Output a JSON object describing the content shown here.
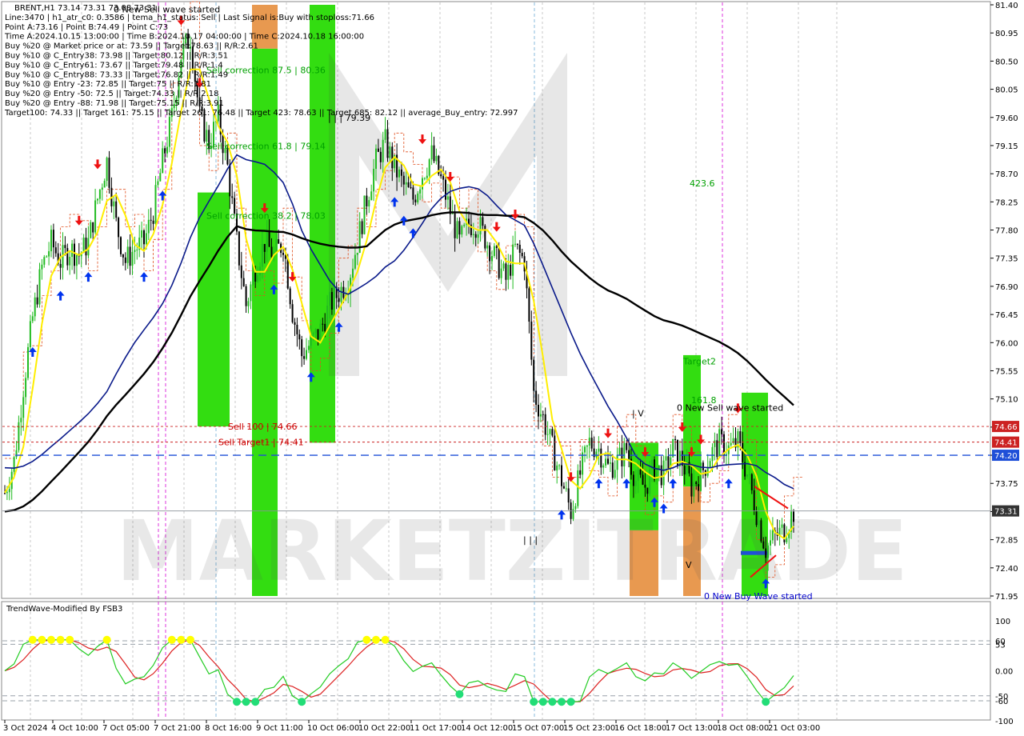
{
  "header": {
    "lines": [
      "BRENT,H1  73.14 73.31 73.08 73.31",
      "Line:3470  |  h1_atr_c0: 0.3586  |  tema_h1_status: Sell  |  Last Signal is:Buy with stoploss:71.66",
      "Point A:73.16  |  Point B:74.49  |  Point C:73",
      "Time A:2024.10.15 13:00:00  |  Time B:2024.10.17 04:00:00  |  Time C:2024.10.18 16:00:00",
      "Buy %20 @ Market price or at: 73.59  ||  Target:78.63  ||  R/R:2.61",
      "Buy %10 @ C_Entry38: 73.98  ||  Target:80.12  ||  R/R:3.51",
      "Buy %10 @ C_Entry61: 73.67  ||  Target:79.48  ||  R/R:1.4",
      "Buy %10 @ C_Entry88: 73.33  ||  Target:76.82  ||  R/R:1.49",
      "Buy %10 @ Entry -23: 72.85  ||  Target:75  ||  R/R:1.81",
      "Buy %20 @ Entry -50: 72.5  ||  Target:74.33  ||  R/R:2.18",
      "Buy %20 @ Entry -88: 71.98  ||  Target:75.15  ||  R/R:3.91",
      "Target100: 74.33  ||  Target 161: 75.15  ||  Target 261: 76.48  ||  Target 423: 78.63  ||  Target 685: 82.12  ||  average_Buy_entry: 72.997"
    ]
  },
  "watermark": "MARKETZITRADE",
  "annotations": [
    {
      "text": "0 New Sell wave started",
      "color": "#000000",
      "price": 81.33,
      "x": 142
    },
    {
      "text": "Sell correction 87.5 | 80.36",
      "color": "#00a000",
      "price": 80.36,
      "x": 258
    },
    {
      "text": "| | | 79.39",
      "color": "#000000",
      "price": 79.6,
      "x": 410
    },
    {
      "text": "Sell correction 61.8 | 79.14",
      "color": "#00a000",
      "price": 79.14,
      "x": 258
    },
    {
      "text": "Sell correction 38.2 | 78.03",
      "color": "#00a000",
      "price": 78.03,
      "x": 258
    },
    {
      "text": "423.6",
      "color": "#00a000",
      "price": 78.55,
      "x": 862
    },
    {
      "text": "Target2",
      "color": "#00a000",
      "price": 75.7,
      "x": 854
    },
    {
      "text": "161.8",
      "color": "#00a000",
      "price": 75.08,
      "x": 864
    },
    {
      "text": "0 New Sell wave started",
      "color": "#000000",
      "price": 74.96,
      "x": 846
    },
    {
      "text": "| V",
      "color": "#000000",
      "price": 74.87,
      "x": 790
    },
    {
      "text": "Sell 100 | 74.66",
      "color": "#cc0000",
      "price": 74.66,
      "x": 285
    },
    {
      "text": "Sell Target1 | 74.41",
      "color": "#cc0000",
      "price": 74.41,
      "x": 273
    },
    {
      "text": "| | |",
      "color": "#000000",
      "price": 72.85,
      "x": 654
    },
    {
      "text": "V",
      "color": "#000000",
      "price": 72.45,
      "x": 857
    },
    {
      "text": "0 New Buy Wave started",
      "color": "#0000cc",
      "price": 71.95,
      "x": 880
    }
  ],
  "price_tags": [
    {
      "label": "74.66",
      "price": 74.66,
      "color": "#cc2222"
    },
    {
      "label": "74.41",
      "price": 74.41,
      "color": "#cc2222"
    },
    {
      "label": "74.20",
      "price": 74.2,
      "color": "#1f4fd8"
    },
    {
      "label": "73.31",
      "price": 73.31,
      "color": "#333333"
    }
  ],
  "indicator": {
    "title": "TrendWave-Modified By FSB3",
    "ticks": [
      "100",
      "60",
      "53",
      "0.00",
      "-50",
      "-60",
      "-100"
    ],
    "fast_color": "#22cc22",
    "slow_color": "#dd2222",
    "dot_colors": {
      "top": "#ffff00",
      "bottom": "#22dd77"
    }
  },
  "colors": {
    "bull_candle": "#22bb22",
    "bear_candle": "#000000",
    "green_zone": "#33dd11",
    "orange_zone": "#e89950",
    "ma_fast": "#ffee00",
    "ma_mid": "#0a1a8a",
    "ma_slow": "#000000",
    "buy_arrow": "#0033ee",
    "sell_arrow": "#ee1111"
  },
  "chart_data": {
    "type": "candlestick",
    "symbol": "BRENT",
    "timeframe": "H1",
    "ohlc_last": {
      "open": 73.14,
      "high": 73.31,
      "low": 73.08,
      "close": 73.31
    },
    "y_ticks": [
      "81.40",
      "80.95",
      "80.50",
      "80.05",
      "79.60",
      "79.15",
      "78.70",
      "78.25",
      "77.80",
      "77.35",
      "76.90",
      "76.45",
      "76.00",
      "75.55",
      "75.10",
      "74.65",
      "74.20",
      "73.75",
      "73.30",
      "72.85",
      "72.40",
      "71.95"
    ],
    "ylim": [
      71.95,
      81.4
    ],
    "x_ticks": [
      "3 Oct 2024",
      "4 Oct 10:00",
      "7 Oct 05:00",
      "7 Oct 21:00",
      "8 Oct 16:00",
      "9 Oct 11:00",
      "10 Oct 06:00",
      "10 Oct 22:00",
      "11 Oct 17:00",
      "14 Oct 12:00",
      "15 Oct 07:00",
      "15 Oct 23:00",
      "16 Oct 18:00",
      "17 Oct 13:00",
      "18 Oct 08:00",
      "21 Oct 03:00"
    ],
    "close_series": [
      73.6,
      74.1,
      75.3,
      76.4,
      77.2,
      77.6,
      77.3,
      77.5,
      77.4,
      77.6,
      78.3,
      78.9,
      77.9,
      77.3,
      77.5,
      77.6,
      78.1,
      78.9,
      79.6,
      80.6,
      80.9,
      79.6,
      79.2,
      79.6,
      78.8,
      77.6,
      76.6,
      77.2,
      77.6,
      77.4,
      77.6,
      76.5,
      75.8,
      76.0,
      76.2,
      76.6,
      76.8,
      77.0,
      77.6,
      78.3,
      78.9,
      79.2,
      78.8,
      78.5,
      78.3,
      78.7,
      79.0,
      78.6,
      78.1,
      77.6,
      77.9,
      77.9,
      77.6,
      77.3,
      77.0,
      77.5,
      77.3,
      75.2,
      74.8,
      74.3,
      73.8,
      73.3,
      73.9,
      74.4,
      74.3,
      74.0,
      74.1,
      74.3,
      73.8,
      73.7,
      74.0,
      73.9,
      74.3,
      74.1,
      73.7,
      73.9,
      74.2,
      74.4,
      74.3,
      74.4,
      73.9,
      73.3,
      72.7,
      72.9,
      73.0,
      73.3
    ],
    "levels": [
      {
        "name": "Sell 100",
        "value": 74.66
      },
      {
        "name": "Sell Target1",
        "value": 74.41
      },
      {
        "name": "current",
        "value": 73.31
      },
      {
        "name": "blue dashed",
        "value": 74.2
      }
    ]
  }
}
